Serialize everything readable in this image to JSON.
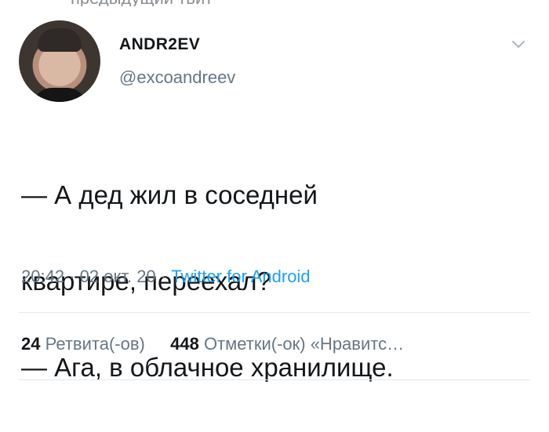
{
  "header": {
    "top_partial_text": "предыдущий твит"
  },
  "tweet": {
    "display_name": "ANDR2EV",
    "handle": "@excoandreev",
    "text_line_1": "— А дед жил в соседней",
    "text_line_2": "квартире, переехал?",
    "text_line_3": "— Ага, в облачное хранилище.",
    "time": "20:42",
    "date": "02 окт. 20",
    "source": "Twitter for Android",
    "retweets_count": "24",
    "retweets_label": "Ретвита(-ов)",
    "likes_count": "448",
    "likes_label": "Отметки(-ок) «Нравитс…"
  },
  "icons": {
    "menu": "chevron-down-icon",
    "avatar": "profile-photo"
  },
  "colors": {
    "text": "#14171a",
    "secondary_text": "#657786",
    "link": "#1da1f2",
    "divider": "#e1e8ed"
  }
}
